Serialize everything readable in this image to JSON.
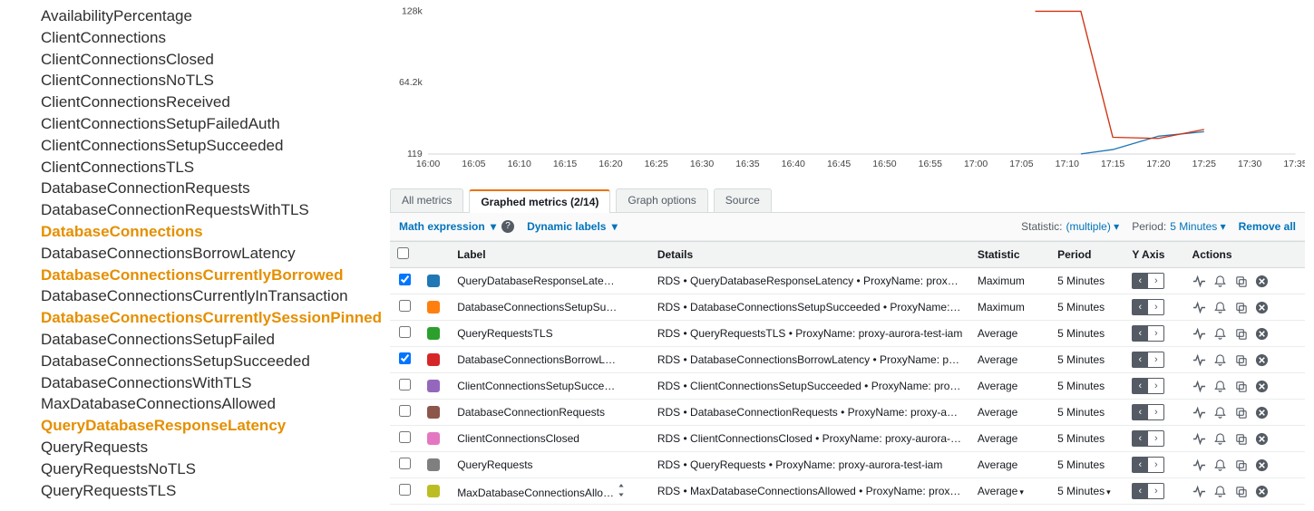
{
  "left_metrics": [
    {
      "label": "AvailabilityPercentage",
      "highlight": false
    },
    {
      "label": "ClientConnections",
      "highlight": false
    },
    {
      "label": "ClientConnectionsClosed",
      "highlight": false
    },
    {
      "label": "ClientConnectionsNoTLS",
      "highlight": false
    },
    {
      "label": "ClientConnectionsReceived",
      "highlight": false
    },
    {
      "label": "ClientConnectionsSetupFailedAuth",
      "highlight": false
    },
    {
      "label": "ClientConnectionsSetupSucceeded",
      "highlight": false
    },
    {
      "label": "ClientConnectionsTLS",
      "highlight": false
    },
    {
      "label": "DatabaseConnectionRequests",
      "highlight": false
    },
    {
      "label": "DatabaseConnectionRequestsWithTLS",
      "highlight": false
    },
    {
      "label": "DatabaseConnections",
      "highlight": true
    },
    {
      "label": "DatabaseConnectionsBorrowLatency",
      "highlight": false
    },
    {
      "label": "DatabaseConnectionsCurrentlyBorrowed",
      "highlight": true
    },
    {
      "label": "DatabaseConnectionsCurrentlyInTransaction",
      "highlight": false
    },
    {
      "label": "DatabaseConnectionsCurrentlySessionPinned",
      "highlight": true
    },
    {
      "label": "DatabaseConnectionsSetupFailed",
      "highlight": false
    },
    {
      "label": "DatabaseConnectionsSetupSucceeded",
      "highlight": false
    },
    {
      "label": "DatabaseConnectionsWithTLS",
      "highlight": false
    },
    {
      "label": "MaxDatabaseConnectionsAllowed",
      "highlight": false
    },
    {
      "label": "QueryDatabaseResponseLatency",
      "highlight": true
    },
    {
      "label": "QueryRequests",
      "highlight": false
    },
    {
      "label": "QueryRequestsNoTLS",
      "highlight": false
    },
    {
      "label": "QueryRequestsTLS",
      "highlight": false
    }
  ],
  "chart_data": {
    "type": "line",
    "y_ticks": [
      "128k",
      "64.2k",
      "119"
    ],
    "x_ticks": [
      "16:00",
      "16:05",
      "16:10",
      "16:15",
      "16:20",
      "16:25",
      "16:30",
      "16:35",
      "16:40",
      "16:45",
      "16:50",
      "16:55",
      "17:00",
      "17:05",
      "17:10",
      "17:15",
      "17:20",
      "17:25",
      "17:30",
      "17:35"
    ],
    "series": [
      {
        "name": "QueryDatabaseResponseLatency",
        "color": "#1f77b4",
        "points": [
          [
            13.3,
            null
          ],
          [
            14.3,
            119
          ],
          [
            15.0,
            4000
          ],
          [
            16.0,
            16000
          ],
          [
            17.0,
            20000
          ]
        ]
      },
      {
        "name": "DatabaseConnectionsBorrowLatency",
        "color": "#d13212",
        "points": [
          [
            13.3,
            128000
          ],
          [
            14.3,
            128000
          ],
          [
            15.0,
            15000
          ],
          [
            16.0,
            14000
          ],
          [
            17.0,
            22000
          ]
        ]
      }
    ],
    "ylim": [
      0,
      130000
    ]
  },
  "tabs": {
    "all_metrics": "All metrics",
    "graphed_metrics": "Graphed metrics (2/14)",
    "graph_options": "Graph options",
    "source": "Source"
  },
  "options_bar": {
    "math_expression": "Math expression",
    "dynamic_labels": "Dynamic labels",
    "statistic_label": "Statistic:",
    "statistic_value": "(multiple)",
    "period_label": "Period:",
    "period_value": "5 Minutes",
    "remove_all": "Remove all"
  },
  "table": {
    "headers": {
      "label": "Label",
      "details": "Details",
      "statistic": "Statistic",
      "period": "Period",
      "yaxis": "Y Axis",
      "actions": "Actions"
    },
    "rows": [
      {
        "checked": true,
        "color": "#1f77b4",
        "label": "QueryDatabaseResponseLate…",
        "details": "RDS • QueryDatabaseResponseLatency • ProxyName: proxy…",
        "statistic": "Maximum",
        "period": "5 Minutes",
        "updown": false,
        "dd": false
      },
      {
        "checked": false,
        "color": "#ff7f0e",
        "label": "DatabaseConnectionsSetupSu…",
        "details": "RDS • DatabaseConnectionsSetupSucceeded • ProxyName:…",
        "statistic": "Maximum",
        "period": "5 Minutes",
        "updown": false,
        "dd": false
      },
      {
        "checked": false,
        "color": "#2ca02c",
        "label": "QueryRequestsTLS",
        "details": "RDS • QueryRequestsTLS • ProxyName: proxy-aurora-test-iam",
        "statistic": "Average",
        "period": "5 Minutes",
        "updown": false,
        "dd": false
      },
      {
        "checked": true,
        "color": "#d62728",
        "label": "DatabaseConnectionsBorrowL…",
        "details": "RDS • DatabaseConnectionsBorrowLatency • ProxyName: pr…",
        "statistic": "Average",
        "period": "5 Minutes",
        "updown": false,
        "dd": false
      },
      {
        "checked": false,
        "color": "#9467bd",
        "label": "ClientConnectionsSetupSucce…",
        "details": "RDS • ClientConnectionsSetupSucceeded • ProxyName: pro…",
        "statistic": "Average",
        "period": "5 Minutes",
        "updown": false,
        "dd": false
      },
      {
        "checked": false,
        "color": "#8c564b",
        "label": "DatabaseConnectionRequests",
        "details": "RDS • DatabaseConnectionRequests • ProxyName: proxy-a…",
        "statistic": "Average",
        "period": "5 Minutes",
        "updown": false,
        "dd": false
      },
      {
        "checked": false,
        "color": "#e377c2",
        "label": "ClientConnectionsClosed",
        "details": "RDS • ClientConnectionsClosed • ProxyName: proxy-aurora-…",
        "statistic": "Average",
        "period": "5 Minutes",
        "updown": false,
        "dd": false
      },
      {
        "checked": false,
        "color": "#7f7f7f",
        "label": "QueryRequests",
        "details": "RDS • QueryRequests • ProxyName: proxy-aurora-test-iam",
        "statistic": "Average",
        "period": "5 Minutes",
        "updown": false,
        "dd": false
      },
      {
        "checked": false,
        "color": "#bcbd22",
        "label": "MaxDatabaseConnectionsAllo…",
        "details": "RDS • MaxDatabaseConnectionsAllowed • ProxyName: prox…",
        "statistic": "Average",
        "period": "5 Minutes",
        "updown": true,
        "dd": true
      }
    ]
  }
}
